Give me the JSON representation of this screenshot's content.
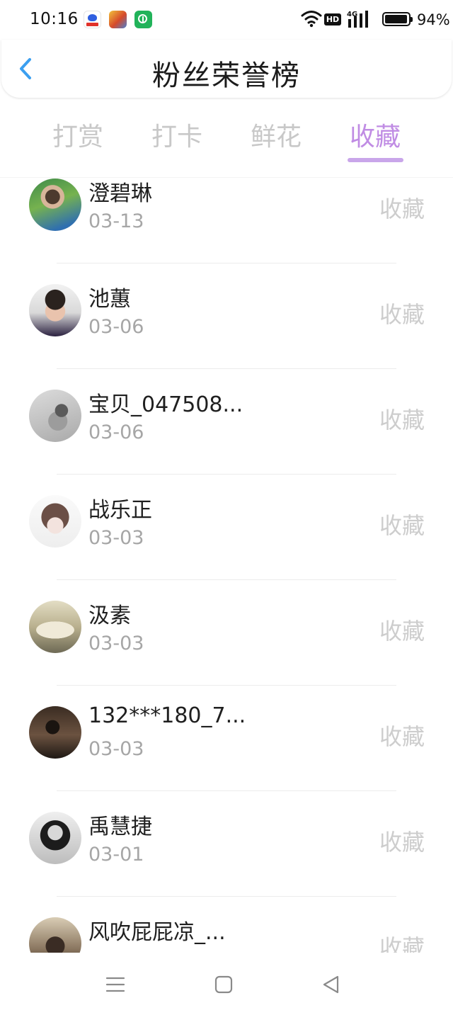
{
  "status_bar": {
    "time": "10:16",
    "network": "4G",
    "hd": "HD",
    "battery": "94%"
  },
  "header": {
    "title": "粉丝荣誉榜",
    "back_icon": "chevron-left-icon"
  },
  "tabs": [
    {
      "label": "打赏",
      "active": false
    },
    {
      "label": "打卡",
      "active": false
    },
    {
      "label": "鲜花",
      "active": false
    },
    {
      "label": "收藏",
      "active": true
    }
  ],
  "colors": {
    "accent": "#c08ce4",
    "back_arrow": "#3b9ff0",
    "inactive_text": "#c8c8c8"
  },
  "fans": [
    {
      "name": "澄碧琳",
      "date": "03-13",
      "action": "收藏"
    },
    {
      "name": "池蕙",
      "date": "03-06",
      "action": "收藏"
    },
    {
      "name": "宝贝_047508...",
      "date": "03-06",
      "action": "收藏"
    },
    {
      "name": "战乐正",
      "date": "03-03",
      "action": "收藏"
    },
    {
      "name": "汲素",
      "date": "03-03",
      "action": "收藏"
    },
    {
      "name": "132***180_7...",
      "date": "03-03",
      "action": "收藏"
    },
    {
      "name": "禹慧捷",
      "date": "03-01",
      "action": "收藏"
    },
    {
      "name": "风吹屁屁凉_...",
      "date": "",
      "action": "收藏"
    }
  ]
}
